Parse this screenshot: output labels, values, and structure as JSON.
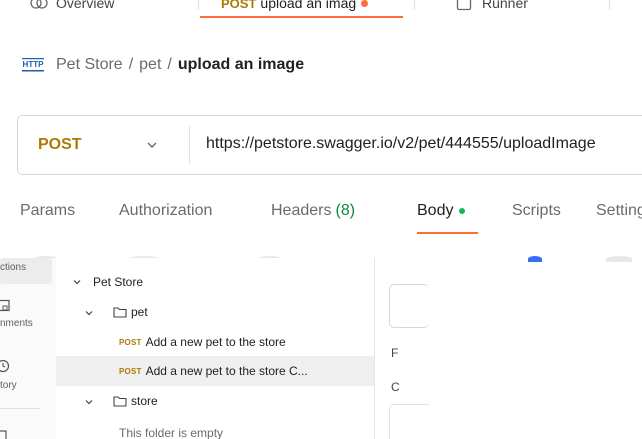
{
  "top_tabs": {
    "overview_label": "Overview",
    "active_method": "POST",
    "active_label": "upload an imag",
    "runner_label": "Runner"
  },
  "breadcrumb": {
    "root": "Pet Store",
    "separator": "/",
    "folder": "pet",
    "current": "upload an image"
  },
  "request": {
    "method": "POST",
    "url": "https://petstore.swagger.io/v2/pet/444555/uploadImage"
  },
  "request_tabs": [
    {
      "label": "Params"
    },
    {
      "label": "Authorization"
    },
    {
      "label": "Headers",
      "count": "(8)"
    },
    {
      "label": "Body",
      "active": true
    },
    {
      "label": "Scripts"
    },
    {
      "label": "Settings"
    }
  ],
  "rail": {
    "items": [
      {
        "label": "ctions",
        "icon": "collections-icon"
      },
      {
        "label": "nments",
        "icon": "environments-icon"
      },
      {
        "label": "tory",
        "icon": "history-icon"
      },
      {
        "label": "",
        "icon": "more-icon"
      }
    ]
  },
  "tree": {
    "collection": "Pet Store",
    "folder_pet": "pet",
    "item1_badge": "POST",
    "item1": "Add a new pet to the store",
    "item2_badge": "POST",
    "item2": "Add a new pet to the store C...",
    "folder_store": "store",
    "empty": "This folder is empty"
  },
  "right_panel": {
    "letter1": "F",
    "letter2": "C"
  },
  "colors": {
    "accent": "#ff6c37",
    "post_method": "#ad7a03",
    "headers_count": "#0f8a3d",
    "body_dot": "#0cbb52"
  }
}
